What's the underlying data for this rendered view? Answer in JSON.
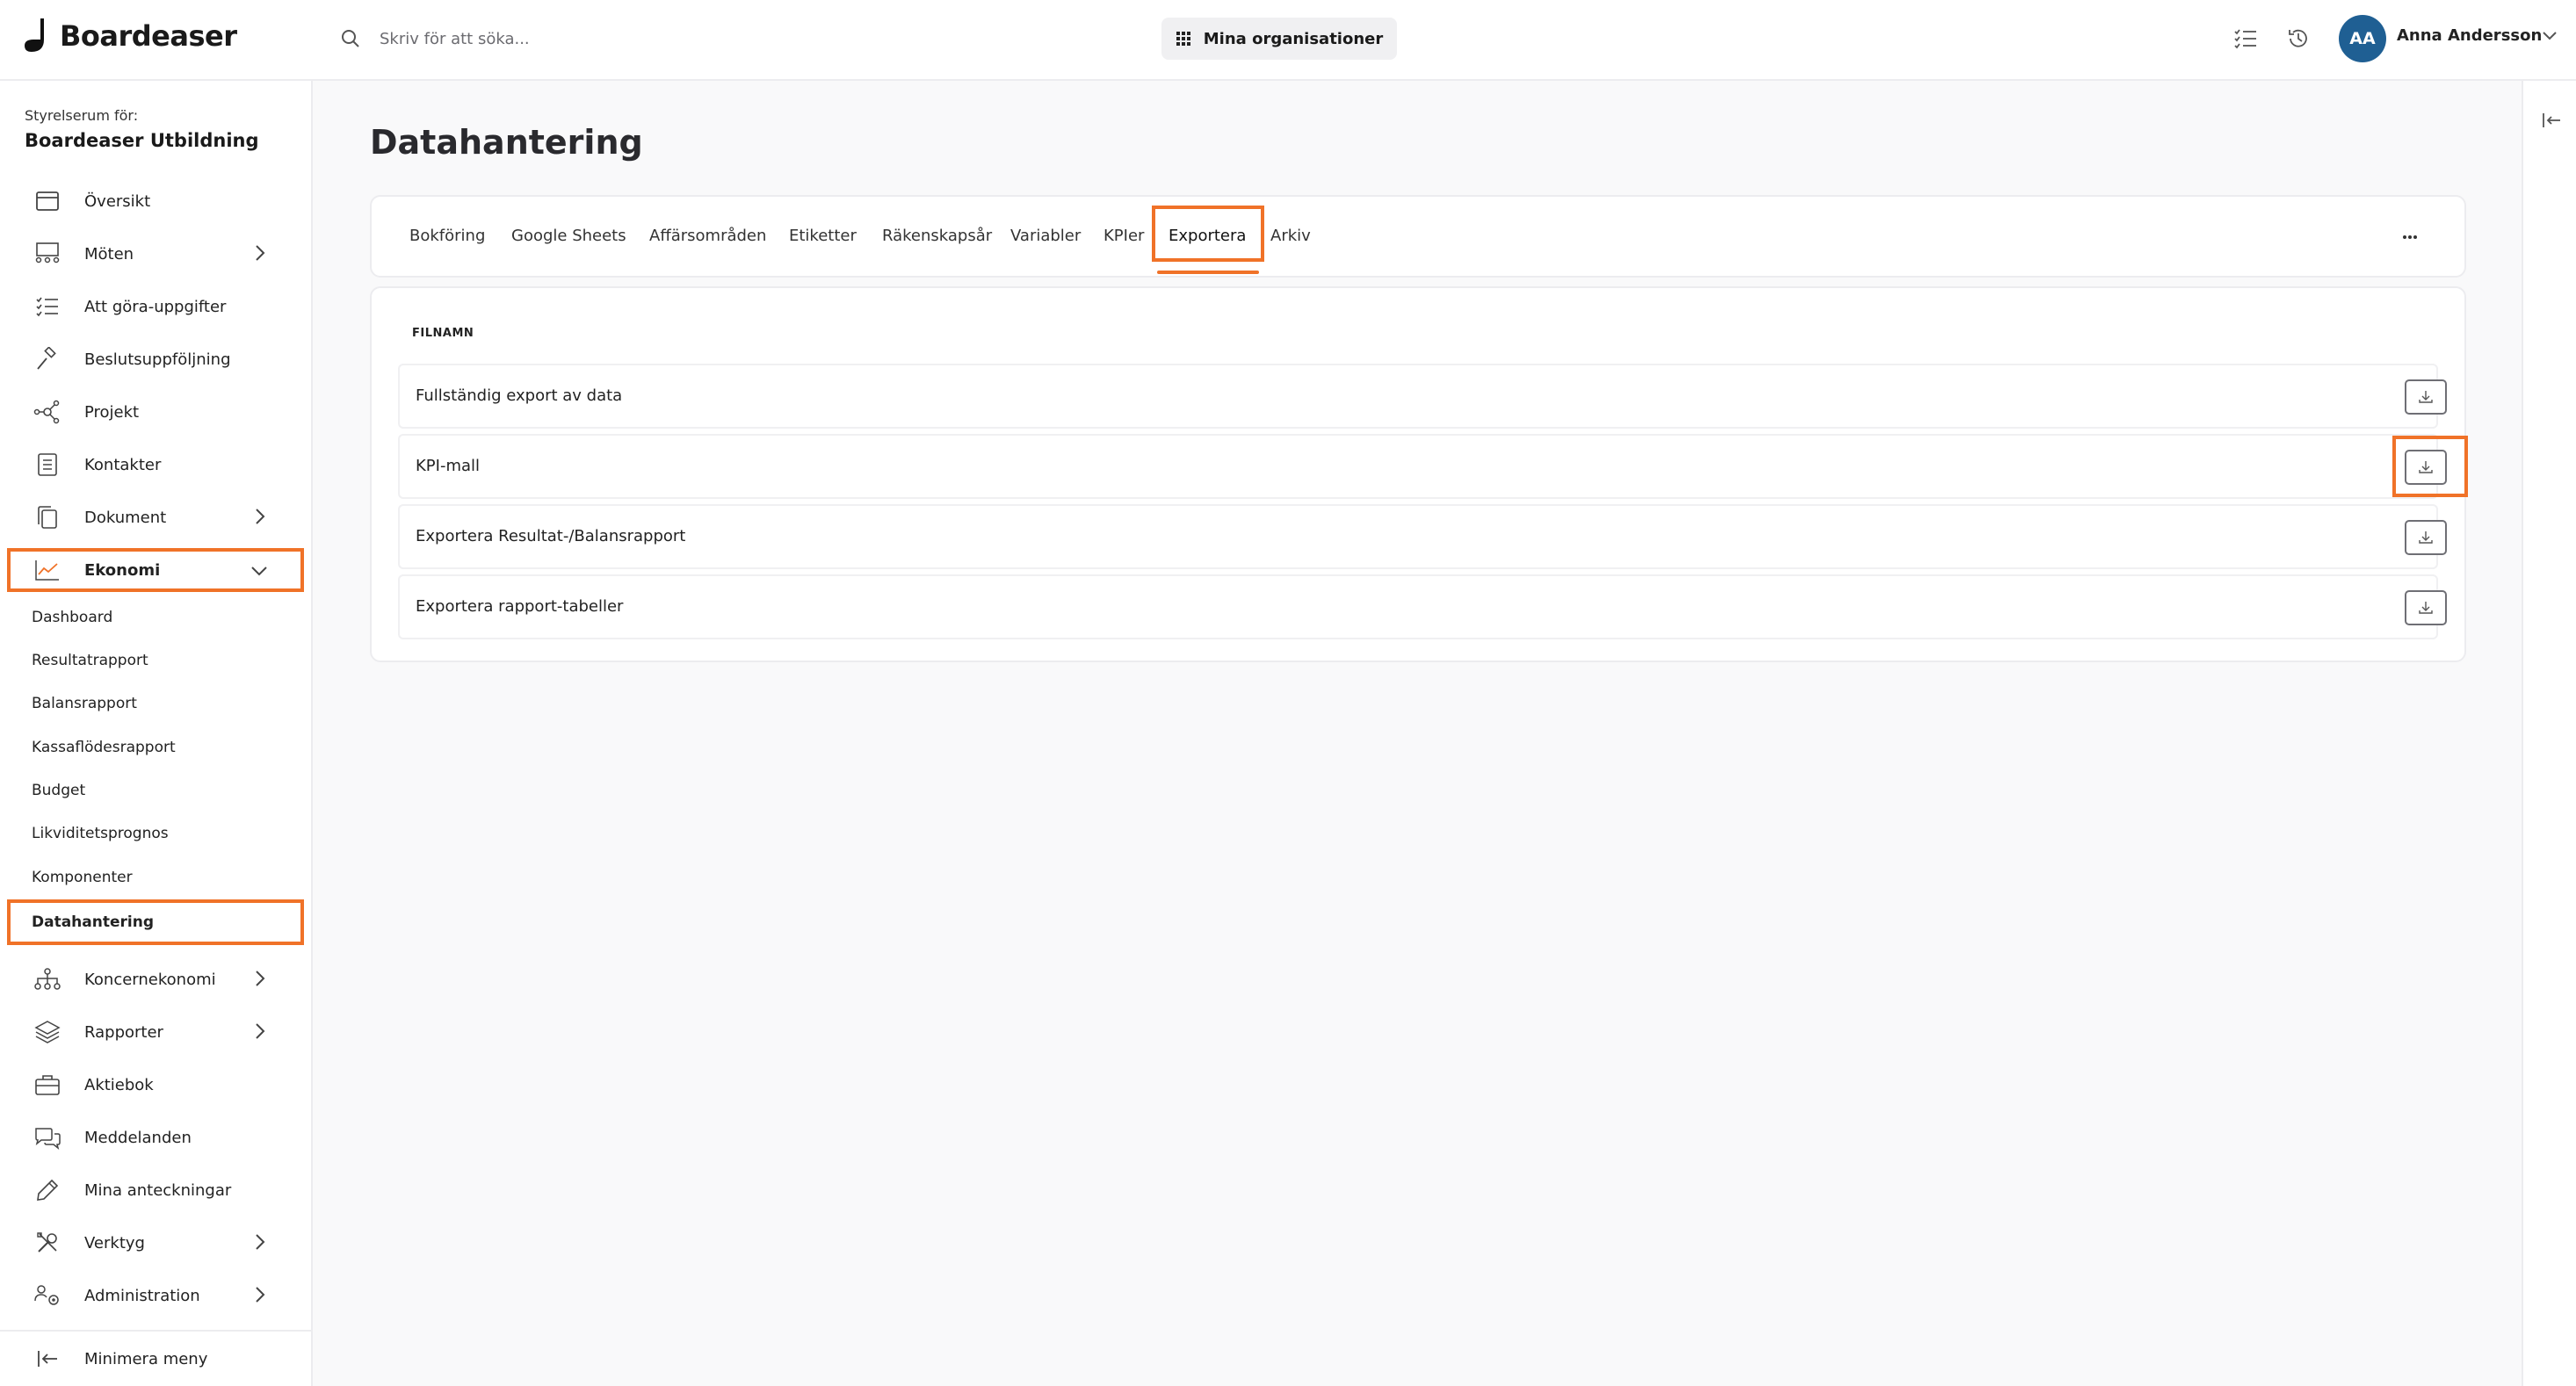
{
  "app": {
    "logo_text": "Boardeaser"
  },
  "header": {
    "search_placeholder": "Skriv för att söka...",
    "org_button": "Mina organisationer",
    "user_initials": "AA",
    "user_name": "Anna Andersson"
  },
  "sidebar": {
    "room_label": "Styrelserum för:",
    "room_name": "Boardeaser Utbildning",
    "items": [
      {
        "label": "Översikt",
        "icon": "calendar-icon"
      },
      {
        "label": "Möten",
        "icon": "meetings-icon"
      },
      {
        "label": "Att göra-uppgifter",
        "icon": "checklist-icon"
      },
      {
        "label": "Beslutsuppföljning",
        "icon": "gavel-icon"
      },
      {
        "label": "Projekt",
        "icon": "network-icon"
      },
      {
        "label": "Kontakter",
        "icon": "contacts-icon"
      },
      {
        "label": "Dokument",
        "icon": "documents-icon"
      },
      {
        "label": "Ekonomi",
        "icon": "chart-line-icon"
      }
    ],
    "ekonomi_sub": [
      "Dashboard",
      "Resultatrapport",
      "Balansrapport",
      "Kassaflödesrapport",
      "Budget",
      "Likviditetsprognos",
      "Komponenter",
      "Datahantering"
    ],
    "items_after": [
      {
        "label": "Koncernekonomi",
        "icon": "hierarchy-icon"
      },
      {
        "label": "Rapporter",
        "icon": "layers-icon"
      },
      {
        "label": "Aktiebok",
        "icon": "briefcase-icon"
      },
      {
        "label": "Meddelanden",
        "icon": "chat-icon"
      },
      {
        "label": "Mina anteckningar",
        "icon": "pencil-icon"
      },
      {
        "label": "Verktyg",
        "icon": "tools-icon"
      },
      {
        "label": "Administration",
        "icon": "users-gear-icon"
      }
    ],
    "collapse_label": "Minimera meny"
  },
  "main": {
    "title": "Datahantering",
    "tabs": [
      "Bokföring",
      "Google Sheets",
      "Affärsområden",
      "Etiketter",
      "Räkenskapsår",
      "Variabler",
      "KPIer",
      "Exportera",
      "Arkiv"
    ],
    "active_tab": "Exportera",
    "column_header": "FILNAMN",
    "files": [
      "Fullständig export av data",
      "KPI-mall",
      "Exportera Resultat-/Balansrapport",
      "Exportera rapport-tabeller"
    ]
  },
  "colors": {
    "highlight": "#f07228",
    "avatar_bg": "#1f5f93",
    "background": "#f9f9fa"
  }
}
